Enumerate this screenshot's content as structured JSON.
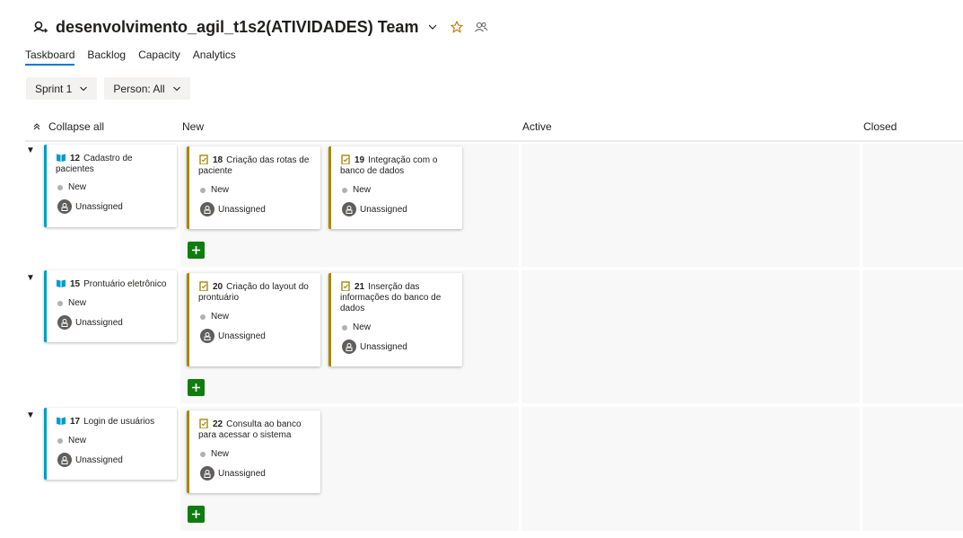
{
  "header": {
    "title": "desenvolvimento_agil_t1s2(ATIVIDADES) Team",
    "team_icon": "team-icon",
    "favorite_icon": "star-icon",
    "members_icon": "people-icon",
    "accent_color": "#0078d4"
  },
  "tabs": [
    {
      "label": "Taskboard",
      "active": true
    },
    {
      "label": "Backlog",
      "active": false
    },
    {
      "label": "Capacity",
      "active": false
    },
    {
      "label": "Analytics",
      "active": false
    }
  ],
  "filters": {
    "sprint": "Sprint 1",
    "person": "Person: All"
  },
  "board": {
    "collapse_all": "Collapse all",
    "columns": [
      "New",
      "Active",
      "Closed"
    ],
    "lanes": [
      {
        "story": {
          "id": "12",
          "title": "Cadastro de pacientes",
          "status": "New",
          "assignee": "Unassigned"
        },
        "tasks": [
          {
            "id": "18",
            "title": "Criação das rotas de paciente",
            "status": "New",
            "assignee": "Unassigned"
          },
          {
            "id": "19",
            "title": "Integração com o banco de dados",
            "status": "New",
            "assignee": "Unassigned"
          }
        ]
      },
      {
        "story": {
          "id": "15",
          "title": "Prontuário eletrônico",
          "status": "New",
          "assignee": "Unassigned"
        },
        "tasks": [
          {
            "id": "20",
            "title": "Criação do layout do prontuário",
            "status": "New",
            "assignee": "Unassigned"
          },
          {
            "id": "21",
            "title": "Inserção das informações do banco de dados",
            "status": "New",
            "assignee": "Unassigned"
          }
        ]
      },
      {
        "story": {
          "id": "17",
          "title": "Login de usuários",
          "status": "New",
          "assignee": "Unassigned"
        },
        "tasks": [
          {
            "id": "22",
            "title": "Consulta ao banco para acessar o sistema",
            "status": "New",
            "assignee": "Unassigned"
          }
        ]
      }
    ],
    "colors": {
      "story": "#009ccc",
      "task": "#a4880a",
      "add_button": "#107c10",
      "state_new": "#b1b1b1"
    }
  }
}
